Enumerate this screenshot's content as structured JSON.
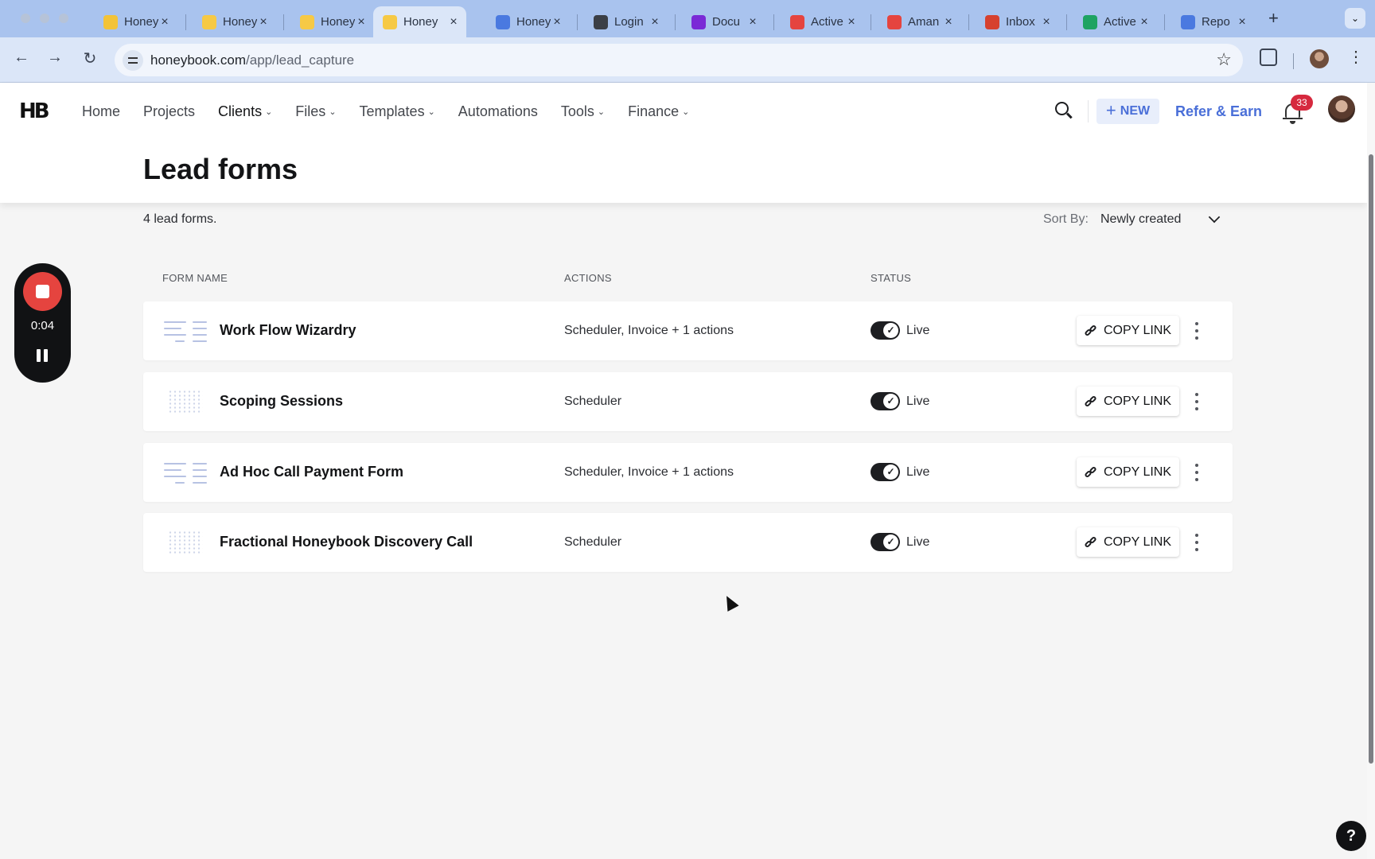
{
  "browser": {
    "tabs": [
      {
        "title": "Honey",
        "favicon": "honeybook-circle-icon",
        "color": "#f3c338"
      },
      {
        "title": "Honey",
        "favicon": "honeybook-icon",
        "color": "#f6c945"
      },
      {
        "title": "Honey",
        "favicon": "honeybook-icon",
        "color": "#f6c945"
      },
      {
        "title": "Honey",
        "favicon": "honeybook-icon",
        "color": "#f6c945"
      },
      {
        "title": "Honey",
        "favicon": "google-docs-icon",
        "color": "#4a79e0"
      },
      {
        "title": "Login",
        "favicon": "onepassword-icon",
        "color": "#3b3f46"
      },
      {
        "title": "Docu",
        "favicon": "docusign-icon",
        "color": "#7a2ad6"
      },
      {
        "title": "Active",
        "favicon": "asana-icon",
        "color": "#e5443f"
      },
      {
        "title": "Aman",
        "favicon": "asana-icon",
        "color": "#e5443f"
      },
      {
        "title": "Inbox",
        "favicon": "gmail-icon",
        "color": "#d6412f"
      },
      {
        "title": "Active",
        "favicon": "google-drive-icon",
        "color": "#1ea362"
      },
      {
        "title": "Repo",
        "favicon": "google-docs-icon",
        "color": "#4a79e0"
      }
    ],
    "active_tab_index": 3,
    "url_host": "honeybook.com",
    "url_path": "/app/lead_capture"
  },
  "header": {
    "logo": "HB",
    "nav": [
      {
        "label": "Home",
        "dropdown": false
      },
      {
        "label": "Projects",
        "dropdown": false
      },
      {
        "label": "Clients",
        "dropdown": true
      },
      {
        "label": "Files",
        "dropdown": true
      },
      {
        "label": "Templates",
        "dropdown": true
      },
      {
        "label": "Automations",
        "dropdown": false
      },
      {
        "label": "Tools",
        "dropdown": true
      },
      {
        "label": "Finance",
        "dropdown": true
      }
    ],
    "new_label": "NEW",
    "refer_label": "Refer & Earn",
    "notification_count": "33"
  },
  "page": {
    "title": "Lead forms",
    "count_text": "4 lead forms.",
    "sort_label": "Sort By:",
    "sort_value": "Newly created"
  },
  "table": {
    "columns": [
      "FORM NAME",
      "ACTIONS",
      "STATUS"
    ],
    "rows": [
      {
        "name": "Work Flow Wizardry",
        "actions": "Scheduler, Invoice + 1 actions",
        "status": "Live",
        "thumb": "list"
      },
      {
        "name": "Scoping Sessions",
        "actions": "Scheduler",
        "status": "Live",
        "thumb": "grid"
      },
      {
        "name": "Ad Hoc Call Payment Form",
        "actions": "Scheduler, Invoice + 1 actions",
        "status": "Live",
        "thumb": "list"
      },
      {
        "name": "Fractional Honeybook Discovery Call",
        "actions": "Scheduler",
        "status": "Live",
        "thumb": "grid"
      }
    ],
    "copy_label": "COPY LINK"
  },
  "recorder": {
    "time": "0:04"
  },
  "help_label": "?"
}
